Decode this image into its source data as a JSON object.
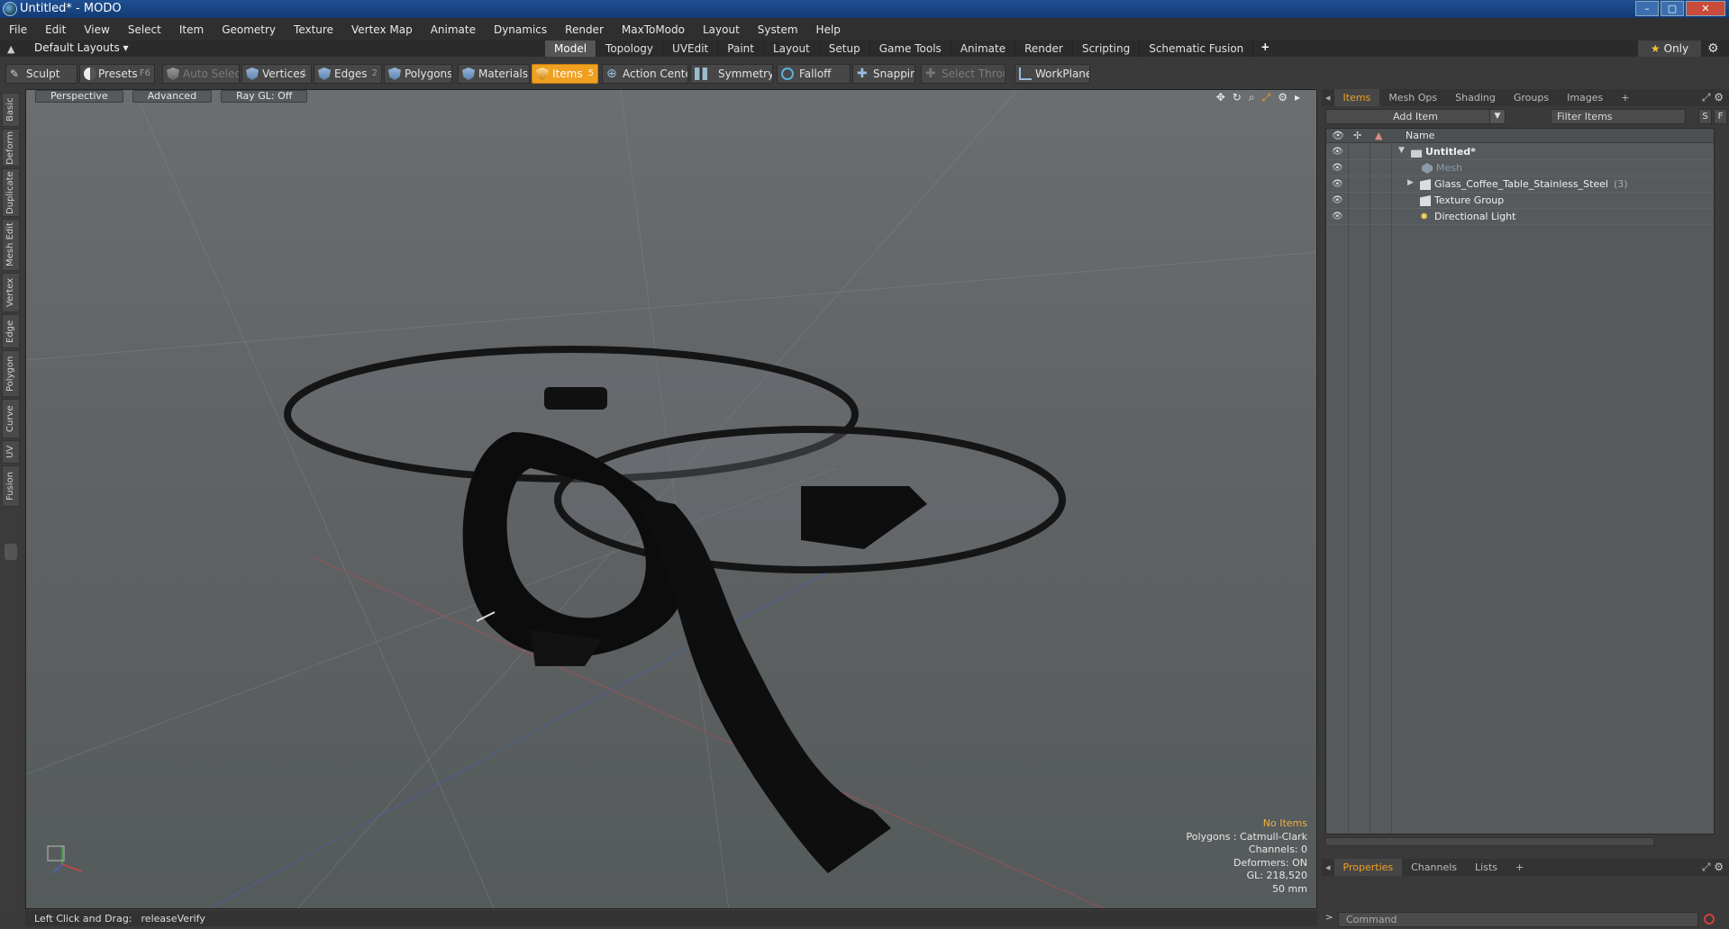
{
  "window": {
    "title": "Untitled* - MODO",
    "min": "–",
    "max": "▢",
    "close": "✕"
  },
  "menu": [
    "File",
    "Edit",
    "View",
    "Select",
    "Item",
    "Geometry",
    "Texture",
    "Vertex Map",
    "Animate",
    "Dynamics",
    "Render",
    "MaxToModo",
    "Layout",
    "System",
    "Help"
  ],
  "layoutbar": {
    "layout_select": "Default Layouts ▾",
    "tabs": [
      "Model",
      "Topology",
      "UVEdit",
      "Paint",
      "Layout",
      "Setup",
      "Game Tools",
      "Animate",
      "Render",
      "Scripting",
      "Schematic Fusion"
    ],
    "active_tab": "Model",
    "add": "+",
    "only_star": "★",
    "only_label": "Only",
    "gear": "⚙"
  },
  "toolbar": {
    "sculpt": "Sculpt",
    "presets": "Presets",
    "presets_key": "F6",
    "auto_select": "Auto Select",
    "vertices": "Vertices",
    "vertices_key": "1",
    "edges": "Edges",
    "edges_key": "2",
    "polygons": "Polygons",
    "materials": "Materials",
    "items": "Items",
    "items_key": "5",
    "action_center": "Action Center",
    "symmetry": "Symmetry",
    "falloff": "Falloff",
    "snapping": "Snapping",
    "select_through": "Select Through",
    "workplane": "WorkPlane"
  },
  "left_tabs": [
    "Basic",
    "Deform",
    "Duplicate",
    "Mesh Edit",
    "Vertex",
    "Edge",
    "Polygon",
    "Curve",
    "UV",
    "Fusion"
  ],
  "viewport": {
    "perspective": "Perspective",
    "advanced": "Advanced",
    "raygl": "Ray GL: Off",
    "info": {
      "no_items": "No Items",
      "polygons": "Polygons : Catmull-Clark",
      "channels": "Channels: 0",
      "deformers": "Deformers: ON",
      "gl": "GL: 218,520",
      "scale": "50 mm"
    }
  },
  "status": {
    "hint": "Left Click and Drag:",
    "command": "releaseVerify"
  },
  "panel": {
    "tabs": [
      "Items",
      "Mesh Ops",
      "Shading",
      "Groups",
      "Images"
    ],
    "active_tab": "Items",
    "add_tab": "+",
    "add_item": "Add Item",
    "filter": "Filter Items",
    "s_btn": "S",
    "f_btn": "F",
    "column_name": "Name",
    "items": [
      {
        "label": "Untitled*",
        "count": ""
      },
      {
        "label": "Mesh",
        "count": ""
      },
      {
        "label": "Glass_Coffee_Table_Stainless_Steel",
        "count": "(3)"
      },
      {
        "label": "Texture Group",
        "count": ""
      },
      {
        "label": "Directional Light",
        "count": ""
      }
    ],
    "bottom_tabs": [
      "Properties",
      "Channels",
      "Lists"
    ],
    "bottom_active": "Properties",
    "command_placeholder": "Command"
  },
  "colors": {
    "accent": "#f0a020",
    "viewport_bg": "#616466",
    "panel_bg": "#3a3a3a"
  }
}
